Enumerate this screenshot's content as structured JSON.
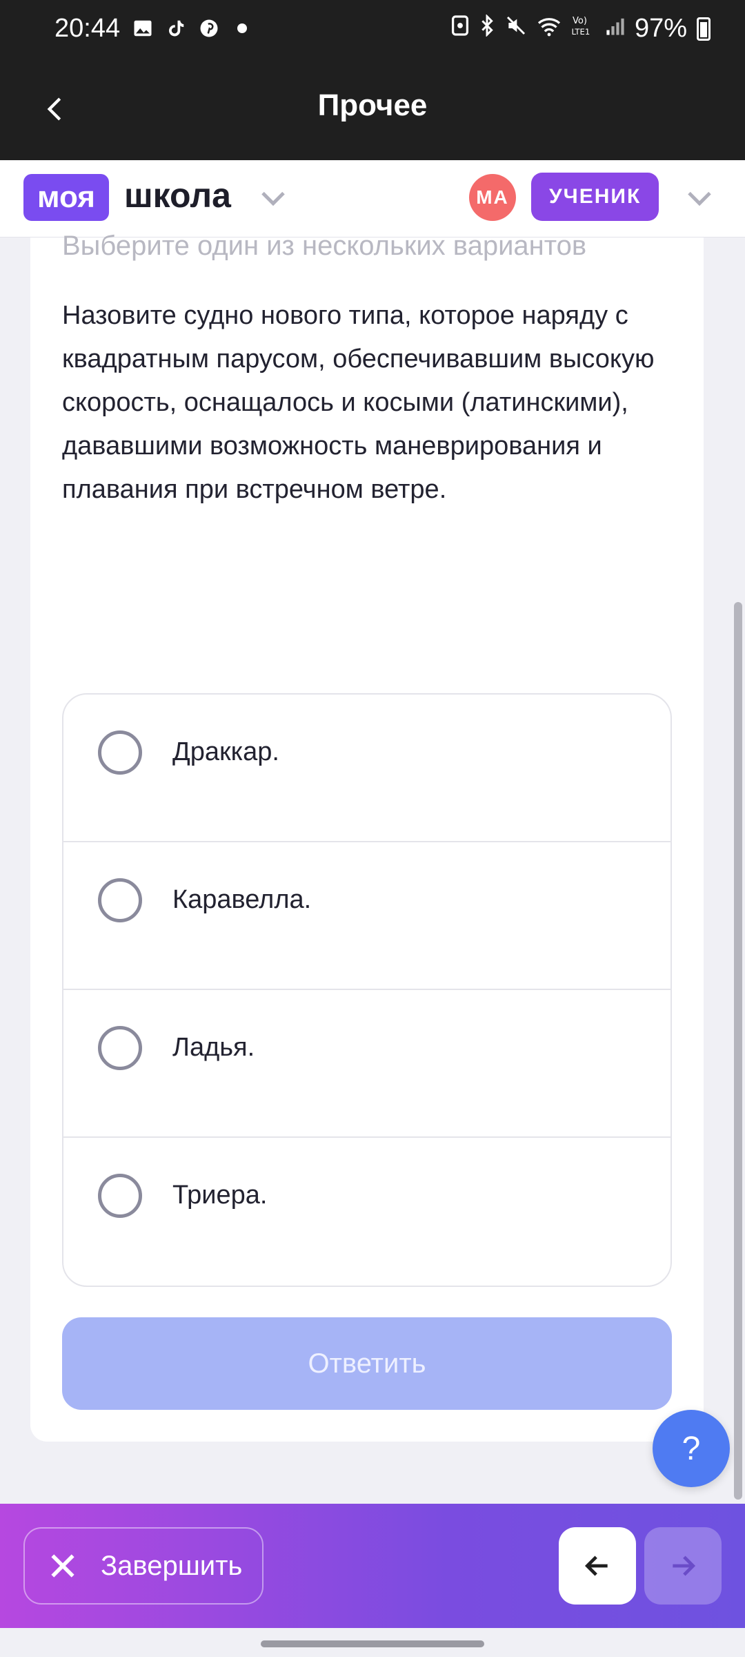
{
  "status_bar": {
    "time": "20:44",
    "battery": "97%",
    "icons_left": [
      "image-icon",
      "tiktok-icon",
      "pinterest-icon",
      "dot-icon"
    ],
    "icons_right": [
      "nfc-icon",
      "bluetooth-icon",
      "mute-icon",
      "wifi-icon",
      "volte-icon",
      "signal-icon",
      "battery-icon"
    ]
  },
  "app_bar": {
    "title": "Прочее"
  },
  "header": {
    "logo_pill": "моя",
    "logo_text": "школа",
    "avatar_initials": "МА",
    "role": "УЧЕНИК"
  },
  "question": {
    "hint": "Выберите один из нескольких вариантов",
    "text": "Назовите судно нового типа, которое наряду с квадратным парусом, обеспечивавшим высокую скорость, оснащалось и косыми (латинскими), дававшими возможность маневрирования и плавания при встречном ветре.",
    "options": [
      "Драккар.",
      "Каравелла.",
      "Ладья.",
      "Триера."
    ],
    "answer_label": "Ответить"
  },
  "help": {
    "label": "?"
  },
  "toolbar": {
    "finish_label": "Завершить"
  },
  "colors": {
    "accent": "#7a4cf0",
    "button_disabled": "#a6b4f6",
    "help": "#4f7bf2",
    "avatar": "#f46a6a"
  }
}
